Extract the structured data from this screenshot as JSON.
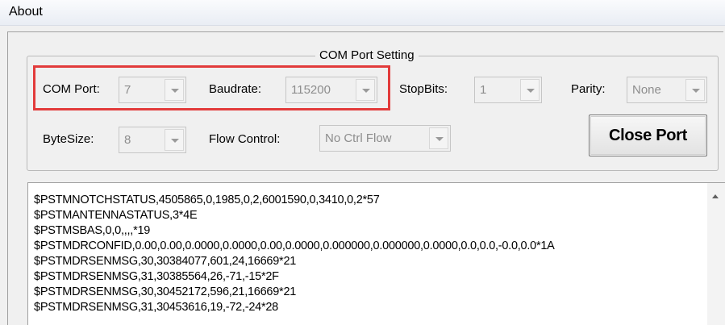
{
  "menu": {
    "about": "About"
  },
  "group": {
    "title": "COM Port Setting"
  },
  "com_port": {
    "label": "COM Port:",
    "value": "7"
  },
  "baudrate": {
    "label": "Baudrate:",
    "value": "115200"
  },
  "stop_bits": {
    "label": "StopBits:",
    "value": "1"
  },
  "parity": {
    "label": "Parity:",
    "value": "None"
  },
  "byte_size": {
    "label": "ByteSize:",
    "value": "8"
  },
  "flow_control": {
    "label": "Flow Control:",
    "value": "No Ctrl Flow"
  },
  "close_port_label": "Close Port",
  "highlight_color": "#e23b3b",
  "log": {
    "lines": [
      "$PSTMNOTCHSTATUS,4505865,0,1985,0,2,6001590,0,3410,0,2*57",
      "$PSTMANTENNASTATUS,3*4E",
      "$PSTMSBAS,0,0,,,,*19",
      "$PSTMDRCONFID,0.00,0.00,0.0000,0.0000,0.00,0.0000,0.000000,0.000000,0.0000,0.0,0.0,-0.0,0.0*1A",
      "$PSTMDRSENMSG,30,30384077,601,24,16669*21",
      "$PSTMDRSENMSG,31,30385564,26,-71,-15*2F",
      "$PSTMDRSENMSG,30,30452172,596,21,16669*21",
      "$PSTMDRSENMSG,31,30453616,19,-72,-24*28"
    ]
  }
}
